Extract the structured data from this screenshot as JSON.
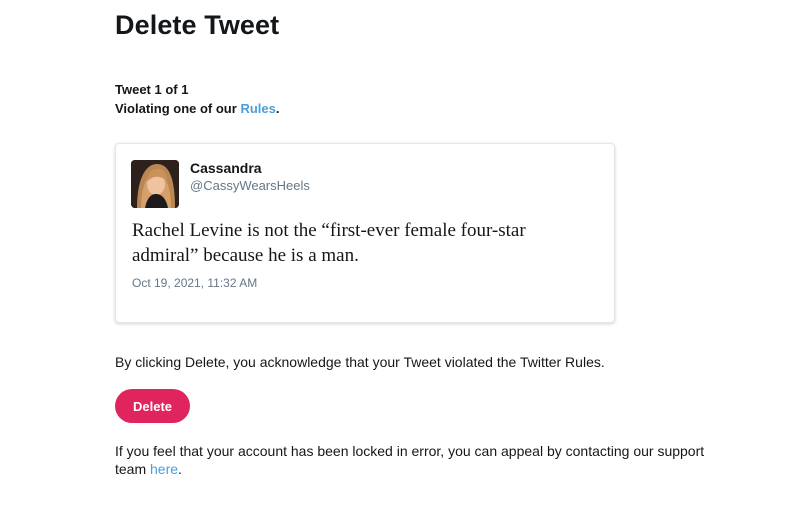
{
  "page": {
    "title": "Delete Tweet"
  },
  "meta": {
    "counter": "Tweet 1 of 1",
    "violation_prefix": "Violating one of our ",
    "rules_link": "Rules",
    "violation_suffix": "."
  },
  "tweet": {
    "display_name": "Cassandra",
    "handle": "@CassyWearsHeels",
    "text": "Rachel Levine is not the “first-ever female four-star admiral” because he is a man.",
    "timestamp": "Oct 19, 2021, 11:32 AM",
    "avatar_icon": "profile-photo"
  },
  "actions": {
    "acknowledge_text": "By clicking Delete, you acknowledge that your Tweet violated the Twitter Rules.",
    "delete_label": "Delete"
  },
  "appeal": {
    "text": "If you feel that your account has been locked in error, you can appeal by contacting our support team ",
    "link_text": "here",
    "suffix": "."
  },
  "colors": {
    "accent_link": "#4a9fd8",
    "delete_button": "#e0245e",
    "muted_text": "#657786"
  }
}
